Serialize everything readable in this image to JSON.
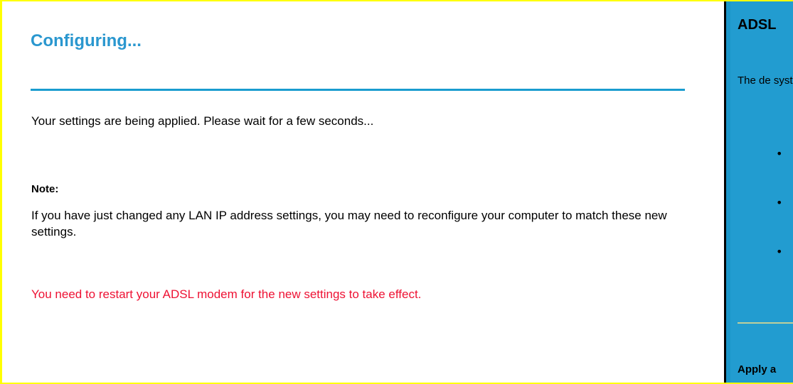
{
  "main": {
    "title": "Configuring...",
    "status_text": "Your settings are being applied. Please wait for a few seconds...",
    "note_heading": "Note:",
    "note_body": "If you have just changed any LAN IP address settings, you may need to reconfigure your computer to match these new settings.",
    "warning_text": "You need to restart your ADSL modem for the new settings to take effect."
  },
  "help_panel": {
    "title": "ADSL",
    "text": "The de system",
    "bullet_glyph": "•",
    "footer": "Apply a"
  },
  "colors": {
    "title": "#2a97cf",
    "rule": "#1a9ccf",
    "warning": "#ee1133",
    "help_background": "#229cd0",
    "frame_border": "#ffff00"
  }
}
